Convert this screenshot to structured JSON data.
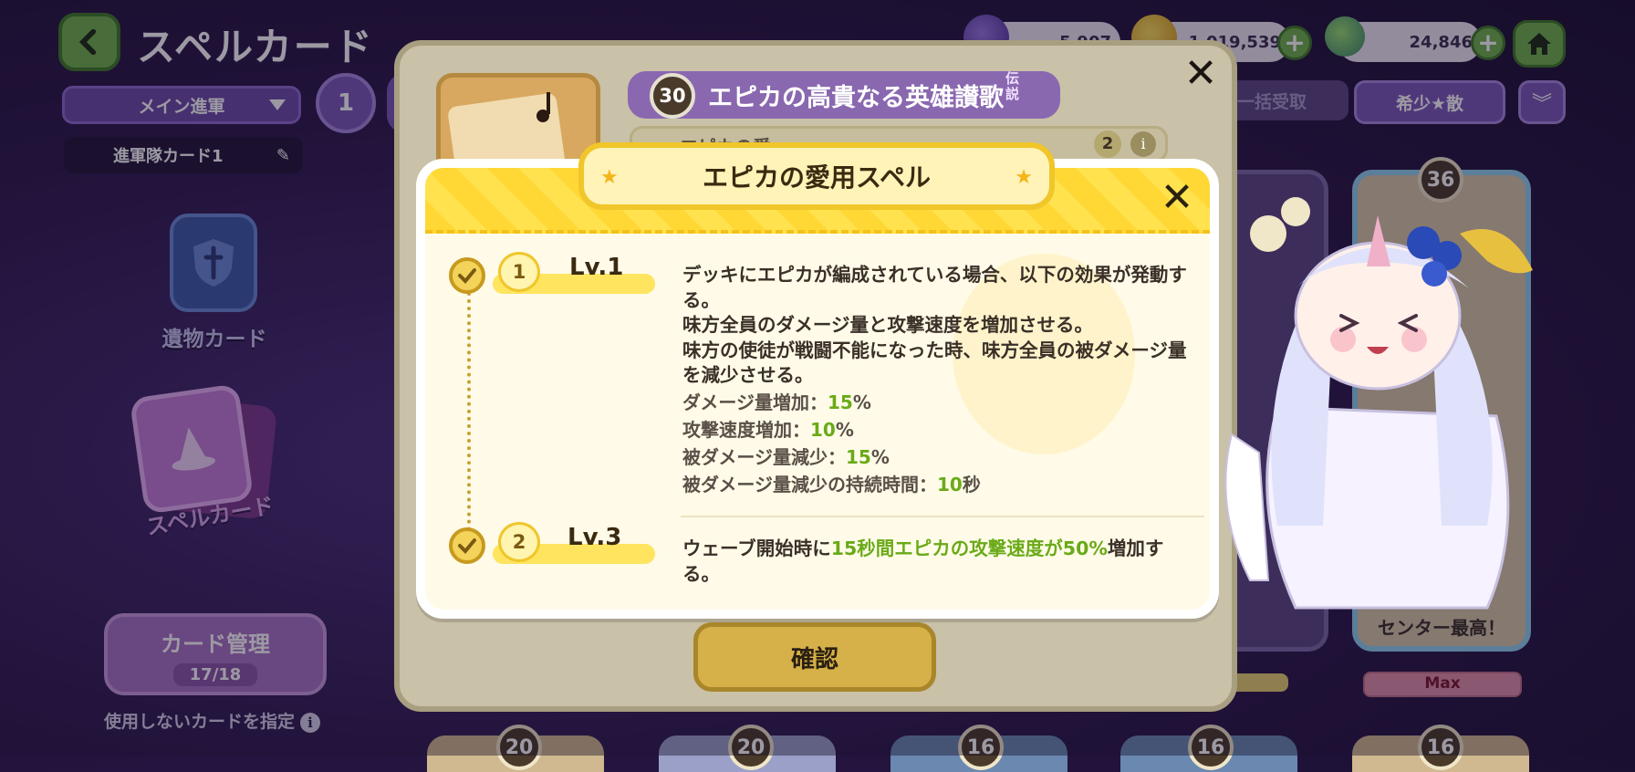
{
  "header": {
    "title": "スペルカード",
    "currencies": [
      {
        "name": "gem",
        "value": "5,907"
      },
      {
        "name": "gold",
        "value": "1,019,539"
      },
      {
        "name": "leaf",
        "value": "24,846"
      }
    ]
  },
  "left_panel": {
    "squad_dropdown": "メイン進軍",
    "squad_number": "1",
    "squad_name": "進軍隊カード1",
    "relic_label": "遺物カード",
    "spell_label": "スペルカード",
    "manage": {
      "label": "カード管理",
      "count": "17/18"
    },
    "unused_label": "使用しないカードを指定"
  },
  "right_controls": {
    "bulk_label": "一括受取",
    "sort_label": "希少★散"
  },
  "background_cards": {
    "top_right": {
      "level": "36",
      "name": "センター最高！",
      "status": "Max"
    },
    "bottom_levels": [
      "20",
      "20",
      "16",
      "16",
      "16"
    ]
  },
  "card_detail": {
    "level": "30",
    "title": "エピカの高貴なる英雄讃歌",
    "rarity": "伝説",
    "sub_count": "2",
    "sub_prefix": "エピカの愛",
    "confirm": "確認"
  },
  "spell_popup": {
    "title": "エピカの愛用スペル",
    "levels": [
      {
        "step": "1",
        "label": "Lv.1",
        "description": "デッキにエピカが編成されている場合、以下の効果が発動する。\n味方全員のダメージ量と攻撃速度を増加させる。\n味方の使徒が戦闘不能になった時、味方全員の被ダメージ量を減少させる。",
        "stats": [
          {
            "name": "ダメージ量増加：",
            "value": "15",
            "unit": "%"
          },
          {
            "name": "攻撃速度増加：",
            "value": "10",
            "unit": "%"
          },
          {
            "name": "被ダメージ量減少：",
            "value": "15",
            "unit": "%"
          },
          {
            "name": "被ダメージ量減少の持続時間：",
            "value": "10",
            "unit": "秒"
          }
        ]
      },
      {
        "step": "2",
        "label": "Lv.3",
        "desc_prefix": "ウェーブ開始時に",
        "desc_highlight": "15秒間エピカの攻撃速度が50%",
        "desc_suffix": "増加する。"
      }
    ]
  },
  "colors": {
    "accent_green": "#6aaa18",
    "popup_header_yellow": "#ffd836",
    "background_purple": "#2a1748",
    "button_green": "#6fb24a"
  }
}
